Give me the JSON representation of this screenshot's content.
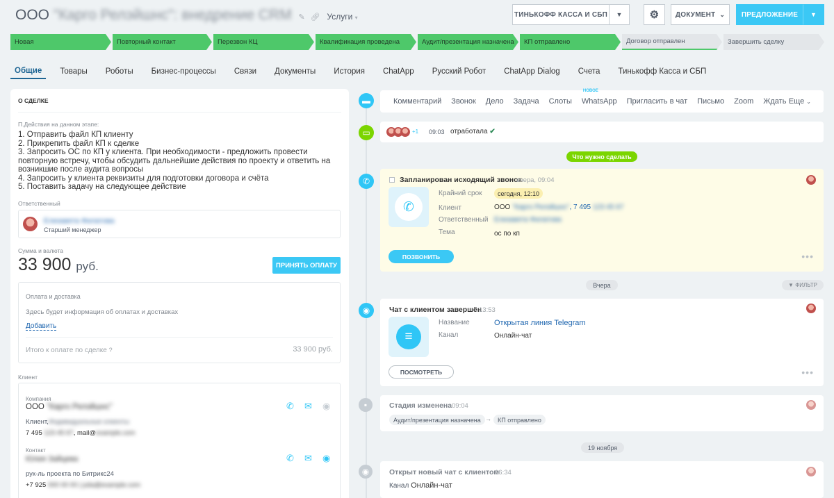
{
  "header": {
    "title_prefix": "ООО",
    "title_rest": "\"Карго Релэйшнс\": внедрение CRM",
    "category": "Услуги",
    "btn_kassa": "ТИНЬКОФФ КАССА И СБП",
    "btn_document": "ДОКУМЕНТ",
    "btn_offer": "ПРЕДЛОЖЕНИЕ"
  },
  "stages": [
    {
      "label": "Новая",
      "state": "done"
    },
    {
      "label": "Повторный контакт",
      "state": "done"
    },
    {
      "label": "Перезвон КЦ",
      "state": "done"
    },
    {
      "label": "Квалификация проведена",
      "state": "done"
    },
    {
      "label": "Аудит/презентация назначена",
      "state": "done"
    },
    {
      "label": "КП отправлено",
      "state": "done"
    },
    {
      "label": "Договор отправлен",
      "state": "current"
    },
    {
      "label": "Завершить сделку",
      "state": "next"
    }
  ],
  "tabs": [
    "Общие",
    "Товары",
    "Роботы",
    "Бизнес-процессы",
    "Связи",
    "Документы",
    "История",
    "ChatApp",
    "Русский Робот",
    "ChatApp Dialog",
    "Счета",
    "Тинькофф Касса и СБП"
  ],
  "deal": {
    "section_title": "О СДЕЛКЕ",
    "notes_label": "П.Действия на данном этапе:",
    "notes": [
      "1. Отправить файл КП клиенту",
      "2. Прикрепить файл КП к сделке",
      "3. Запросить ОС по КП у клиента. При необходимости - предложить провести повторную встречу, чтобы обсудить дальнейшие действия по проекту и ответить на возникшие после аудита вопросы",
      "4. Запросить у клиента реквизиты для подготовки договора и счёта",
      "5. Поставить задачу на следующее действие"
    ],
    "responsible_label": "Ответственный",
    "responsible_name": "Елизавета Филатова",
    "responsible_role": "Старший менеджер",
    "amount_label": "Сумма и валюта",
    "amount": "33 900",
    "currency": "руб.",
    "accept_payment": "ПРИНЯТЬ ОПЛАТУ",
    "payment_title": "Оплата и доставка",
    "payment_info": "Здесь будет информация об оплатах и доставках",
    "payment_add": "Добавить",
    "total_label": "Итого к оплате по сделке",
    "total_value": "33 900 руб.",
    "client_label": "Клиент",
    "company_label": "Компания",
    "company_prefix": "ООО",
    "company_name": "\"Карго Релэйшнс\"",
    "company_client_prefix": "Клиент,",
    "company_client_rest": "Индивидуальные клиенты",
    "company_phone_prefix": "7 495",
    "company_phone_rest": "123 45 67",
    "company_mail_prefix": "mail@",
    "company_mail_rest": "example.com",
    "contact_label": "Контакт",
    "contact_name": "Юлия Зайцева",
    "contact_role": "рук-ль проекта по Битрикс24",
    "contact_phone_prefix": "+7 925",
    "contact_phone_rest": "000 00 00 | julia@example.com"
  },
  "timeline": {
    "actions": [
      "Комментарий",
      "Звонок",
      "Дело",
      "Задача",
      "Слоты",
      "WhatsApp",
      "Пригласить в чат",
      "Письмо",
      "Zoom",
      "Ждать"
    ],
    "new_badge": "НОВОЕ",
    "more": "Еще",
    "chat_count": "+1",
    "chat_time": "09:03",
    "chat_status": "отработала",
    "todo_label": "Что нужно сделать",
    "call": {
      "title": "Запланирован исходящий звонок",
      "time": "вчера, 09:04",
      "deadline_label": "Крайний срок",
      "deadline": "сегодня, 12:10",
      "client_label": "Клиент",
      "client_prefix": "ООО",
      "client_name": "\"Карго Релэйшнс\"",
      "client_phone_prefix": ", 7 495",
      "client_phone_rest": "123 45 67",
      "resp_label": "Ответственный",
      "resp_name": "Елизавета Филатова",
      "topic_label": "Тема",
      "topic": "ос по кп",
      "call_btn": "ПОЗВОНИТЬ"
    },
    "yesterday": "Вчера",
    "filter": "ФИЛЬТР",
    "chat_done": {
      "title": "Чат с клиентом завершён",
      "time": "13:53",
      "name_label": "Название",
      "name": "Открытая линия Telegram",
      "channel_label": "Канал",
      "channel": "Онлайн-чат",
      "view_btn": "ПОСМОТРЕТЬ"
    },
    "stage_change": {
      "title": "Стадия изменена",
      "time": "09:04",
      "from": "Аудит/презентация назначена",
      "to": "КП отправлено"
    },
    "date_sep": "19 ноября",
    "new_chat": {
      "title": "Открыт новый чат с клиентом",
      "time": "16:34",
      "channel_label": "Канал",
      "channel": "Онлайн-чат"
    }
  },
  "colors": {
    "accent": "#3bc8f5",
    "stage_done": "#4ec86a",
    "tab_active": "#1f6694",
    "todo": "#7bd500"
  }
}
